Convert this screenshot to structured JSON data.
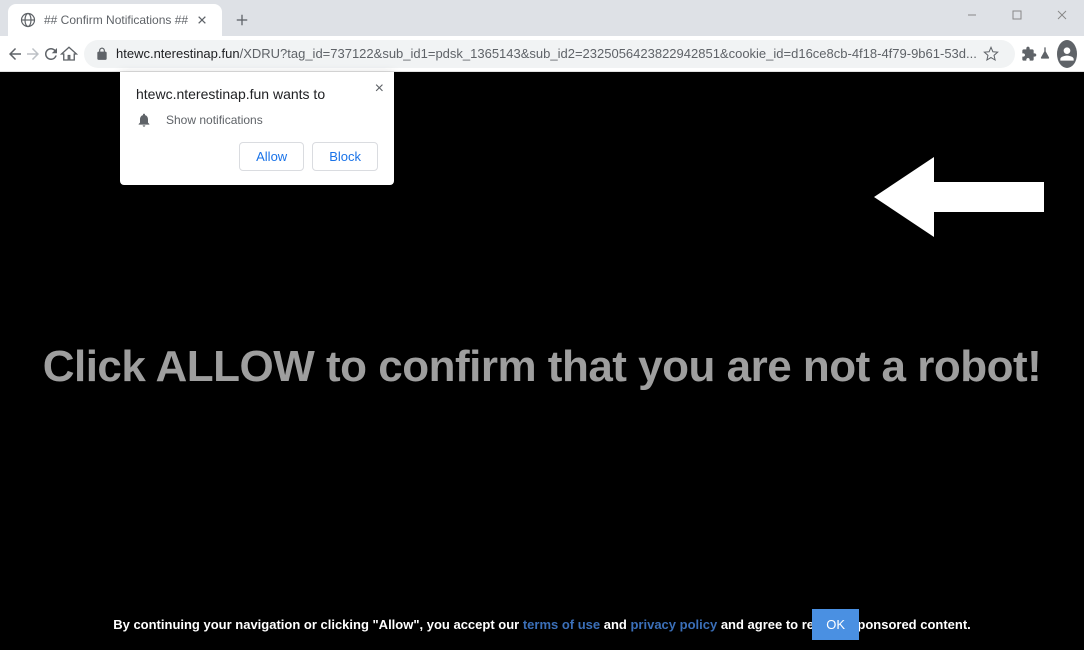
{
  "window": {
    "tab_title": "## Confirm Notifications ##"
  },
  "address": {
    "domain": "htewc.nterestinap.fun",
    "path": "/XDRU?tag_id=737122&sub_id1=pdsk_1365143&sub_id2=2325056423822942851&cookie_id=d16ce8cb-4f18-4f79-9b61-53d..."
  },
  "popup": {
    "title": "htewc.nterestinap.fun wants to",
    "body": "Show notifications",
    "allow": "Allow",
    "block": "Block"
  },
  "page": {
    "main_text": "Click ALLOW to confirm that you are not a robot!",
    "footer_pre": "By continuing your navigation or clicking \"Allow\", you accept our ",
    "footer_terms": "terms of use",
    "footer_and": " and ",
    "footer_privacy": "privacy policy",
    "footer_post": " and agree to receive sponsored content.",
    "ok": "OK"
  }
}
